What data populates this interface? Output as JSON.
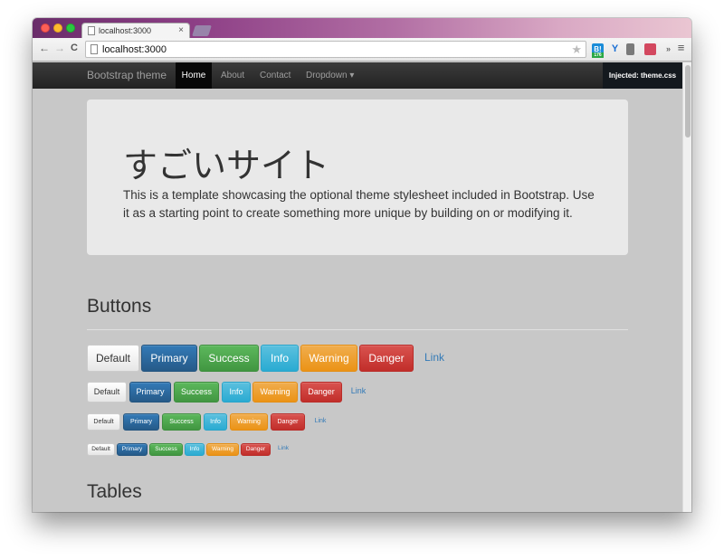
{
  "browser": {
    "tab_title": "localhost:3000",
    "tab_close": "×",
    "url": "localhost:3000",
    "back": "←",
    "forward": "→",
    "reload": "C",
    "star": "★",
    "ext_hatena": "B!",
    "ext_hatena_count": "176",
    "ext_y": "Y",
    "ext_more": "»",
    "ext_menu": "≡"
  },
  "navbar": {
    "brand": "Bootstrap theme",
    "items": [
      {
        "label": "Home",
        "active": true
      },
      {
        "label": "About",
        "active": false
      },
      {
        "label": "Contact",
        "active": false
      },
      {
        "label": "Dropdown ▾",
        "active": false
      }
    ],
    "injected": "Injected: theme.css"
  },
  "jumbotron": {
    "title": "すごいサイト",
    "text": "This is a template showcasing the optional theme stylesheet included in Bootstrap. Use it as a starting point to create something more unique by building on or modifying it."
  },
  "sections": {
    "buttons": "Buttons",
    "tables": "Tables"
  },
  "buttons": {
    "labels": [
      "Default",
      "Primary",
      "Success",
      "Info",
      "Warning",
      "Danger",
      "Link"
    ]
  },
  "colors": {
    "primary": "#337ab7",
    "success": "#5cb85c",
    "info": "#5bc0de",
    "warning": "#f0ad4e",
    "danger": "#d9534f",
    "navbar": "#222222",
    "page_bg": "#c8c8c8"
  }
}
